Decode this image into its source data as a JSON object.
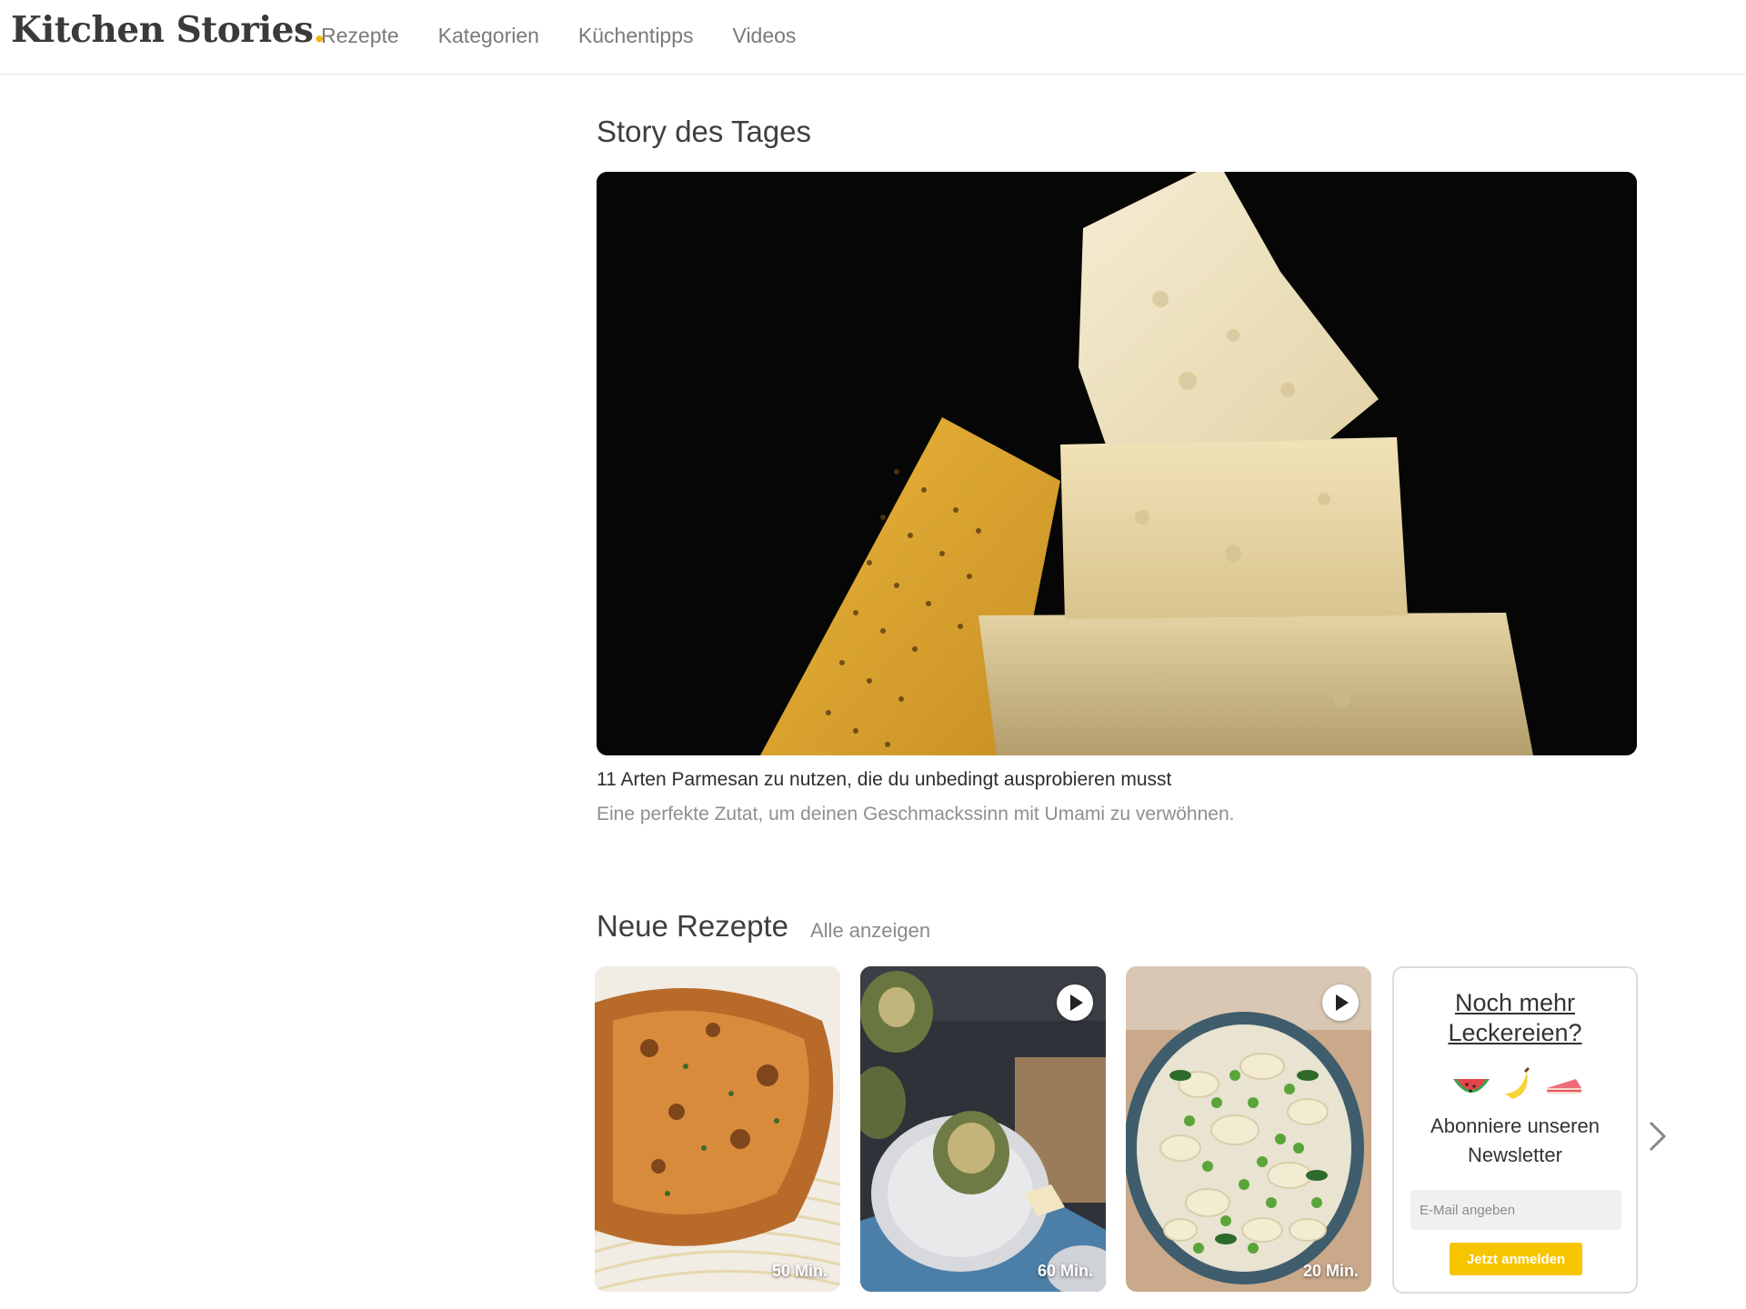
{
  "header": {
    "logo_text": "Kitchen Stories",
    "logo_dot": ".",
    "nav": [
      "Rezepte",
      "Kategorien",
      "Küchentipps",
      "Videos"
    ]
  },
  "story": {
    "section_title": "Story des Tages",
    "title": "11 Arten Parmesan zu nutzen, die du unbedingt ausprobieren musst",
    "subtitle": "Eine perfekte Zutat, um deinen Geschmackssinn mit Umami zu verwöhnen."
  },
  "recipes": {
    "section_title": "Neue Rezepte",
    "see_all": "Alle anzeigen",
    "cards": [
      {
        "time": "50 Min.",
        "video": false
      },
      {
        "time": "60 Min.",
        "video": true
      },
      {
        "time": "20 Min.",
        "video": true
      }
    ]
  },
  "newsletter": {
    "title": "Noch mehr Leckereien?",
    "text": "Abonniere unseren Newsletter",
    "email_placeholder": "E-Mail angeben",
    "button": "Jetzt anmelden"
  },
  "colors": {
    "accent_yellow": "#f7c500",
    "text_dark": "#333333",
    "text_muted": "#8a8a8a"
  }
}
